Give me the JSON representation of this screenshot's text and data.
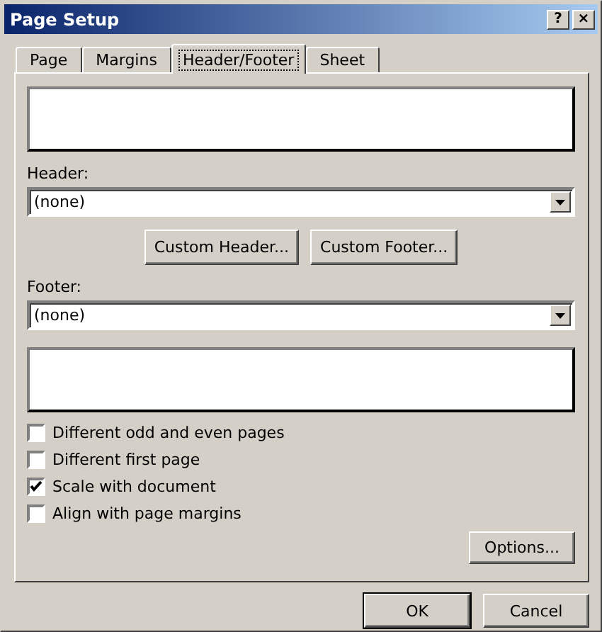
{
  "window": {
    "title": "Page Setup",
    "title_buttons": [
      "?",
      "×"
    ]
  },
  "tabs": [
    {
      "label": "Page",
      "selected": false
    },
    {
      "label": "Margins",
      "selected": false
    },
    {
      "label": "Header/Footer",
      "selected": true
    },
    {
      "label": "Sheet",
      "selected": false
    }
  ],
  "header": {
    "label": "Header:",
    "value": "(none)"
  },
  "custom_buttons": [
    "Custom Header...",
    "Custom Footer..."
  ],
  "footer": {
    "label": "Footer:",
    "value": "(none)"
  },
  "checkboxes": [
    {
      "label": "Different odd and even pages",
      "checked": false
    },
    {
      "label": "Different first page",
      "checked": false
    },
    {
      "label": "Scale with document",
      "checked": true
    },
    {
      "label": "Align with page margins",
      "checked": false
    }
  ],
  "options_button": "Options...",
  "buttons": [
    "OK",
    "Cancel"
  ]
}
